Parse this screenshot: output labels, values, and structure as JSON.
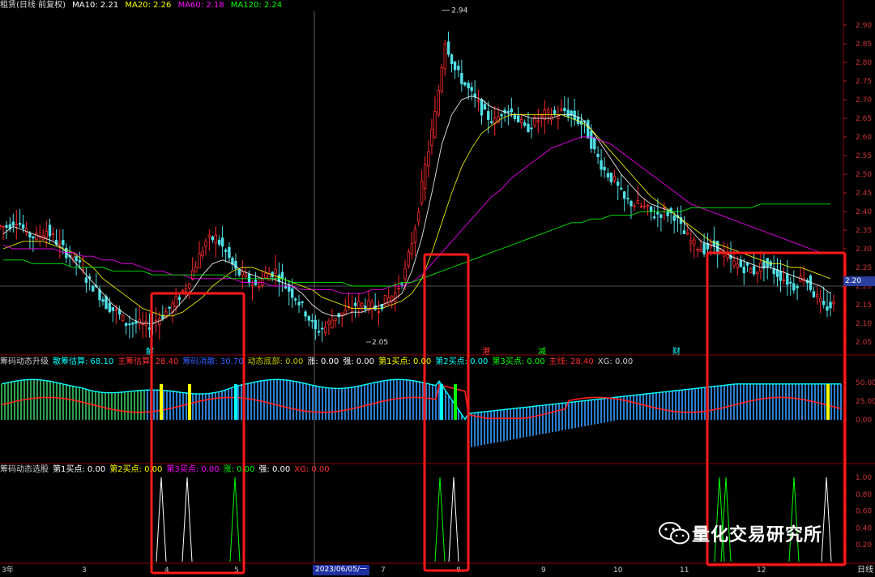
{
  "header": {
    "title": "租赁(日线 前复权)",
    "ma": [
      {
        "label": "MA10: 2.21",
        "color": "#ffffff"
      },
      {
        "label": "MA20: 2.26",
        "color": "#ffff00"
      },
      {
        "label": "MA60: 2.18",
        "color": "#ff00ff"
      },
      {
        "label": "MA120: 2.24",
        "color": "#00ff00"
      }
    ]
  },
  "sub1_header": [
    {
      "label": "筹码动态升级",
      "color": "#cfcfcf"
    },
    {
      "label": "散筹估算: 68.10",
      "color": "#00ffff"
    },
    {
      "label": "主筹估算: 28.40",
      "color": "#ff3030"
    },
    {
      "label": "筹码消散: 30.70",
      "color": "#3060ff"
    },
    {
      "label": "动态底部: 0.00",
      "color": "#c8c800"
    },
    {
      "label": "涨: 0.00",
      "color": "#ffffff"
    },
    {
      "label": "强: 0.00",
      "color": "#ffffff"
    },
    {
      "label": "第1买点: 0.00",
      "color": "#ffff00"
    },
    {
      "label": "第2买点: 0.00",
      "color": "#00ffff"
    },
    {
      "label": "第3买点: 0.00",
      "color": "#00ff00"
    },
    {
      "label": "主线: 28.40",
      "color": "#ff3030"
    },
    {
      "label": "XG: 0.00",
      "color": "#cfcfcf"
    }
  ],
  "sub2_header": [
    {
      "label": "筹码动态选股",
      "color": "#cfcfcf"
    },
    {
      "label": "第1买点: 0.00",
      "color": "#ffffff"
    },
    {
      "label": "第2买点: 0.00",
      "color": "#ffff00"
    },
    {
      "label": "第3买点: 0.00",
      "color": "#ff00ff"
    },
    {
      "label": "涨: 0.00",
      "color": "#00ff00"
    },
    {
      "label": "强: 0.00",
      "color": "#ffffff"
    },
    {
      "label": "XG: 0.00",
      "color": "#ff3030"
    }
  ],
  "annotations": {
    "high_label": "2.94",
    "low_label": "2.05",
    "current_price": "2.20",
    "markers": [
      {
        "text": "解",
        "color": "#00ffff",
        "x": 180
      },
      {
        "text": "港",
        "color": "#ff3030",
        "x": 595
      },
      {
        "text": "减",
        "color": "#00ff00",
        "x": 664
      },
      {
        "text": "财",
        "color": "#00ffff",
        "x": 830
      }
    ]
  },
  "x_axis": {
    "labels": [
      {
        "text": "3年",
        "x": 2
      },
      {
        "text": "3",
        "x": 101
      },
      {
        "text": "4",
        "x": 203
      },
      {
        "text": "5",
        "x": 289
      },
      {
        "text": "7",
        "x": 470
      },
      {
        "text": "8",
        "x": 563
      },
      {
        "text": "9",
        "x": 668
      },
      {
        "text": "10",
        "x": 757
      },
      {
        "text": "11",
        "x": 839
      },
      {
        "text": "12",
        "x": 934
      }
    ],
    "date_box": "2023/06/05/一",
    "timeframe": "日线"
  },
  "watermark": "量化交易研究所",
  "chart_data": [
    {
      "type": "candlestick",
      "title": "租赁(日线 前复权)",
      "y_ticks": [
        "2.90",
        "2.85",
        "2.80",
        "2.75",
        "2.70",
        "2.65",
        "2.60",
        "2.55",
        "2.50",
        "2.45",
        "2.40",
        "2.35",
        "2.30",
        "2.25",
        "2.20",
        "2.15",
        "2.10",
        "2.05"
      ],
      "ylim": [
        2.03,
        2.94
      ],
      "high": 2.94,
      "low": 2.05,
      "current": 2.2,
      "series": [
        {
          "name": "MA10",
          "value": 2.21,
          "color": "#ffffff"
        },
        {
          "name": "MA20",
          "value": 2.26,
          "color": "#ffff00"
        },
        {
          "name": "MA60",
          "value": 2.18,
          "color": "#ff00ff"
        },
        {
          "name": "MA120",
          "value": 2.24,
          "color": "#00ff00"
        }
      ],
      "close_path": [
        2.36,
        2.38,
        2.34,
        2.33,
        2.35,
        2.32,
        2.29,
        2.27,
        2.22,
        2.19,
        2.15,
        2.13,
        2.1,
        2.1,
        2.09,
        2.11,
        2.13,
        2.16,
        2.2,
        2.26,
        2.32,
        2.33,
        2.29,
        2.24,
        2.22,
        2.2,
        2.23,
        2.24,
        2.2,
        2.17,
        2.13,
        2.08,
        2.09,
        2.12,
        2.13,
        2.15,
        2.15,
        2.14,
        2.16,
        2.18,
        2.24,
        2.36,
        2.52,
        2.66,
        2.86,
        2.78,
        2.74,
        2.7,
        2.66,
        2.64,
        2.68,
        2.66,
        2.62,
        2.64,
        2.66,
        2.66,
        2.67,
        2.65,
        2.63,
        2.56,
        2.51,
        2.48,
        2.43,
        2.42,
        2.41,
        2.39,
        2.4,
        2.39,
        2.34,
        2.31,
        2.3,
        2.31,
        2.28,
        2.26,
        2.25,
        2.24,
        2.26,
        2.24,
        2.22,
        2.2,
        2.23,
        2.18,
        2.14,
        2.15
      ],
      "ma10_path": [
        2.34,
        2.36,
        2.35,
        2.34,
        2.33,
        2.32,
        2.3,
        2.27,
        2.24,
        2.21,
        2.18,
        2.15,
        2.13,
        2.11,
        2.1,
        2.1,
        2.11,
        2.13,
        2.16,
        2.19,
        2.23,
        2.26,
        2.27,
        2.26,
        2.24,
        2.23,
        2.22,
        2.22,
        2.21,
        2.2,
        2.18,
        2.15,
        2.13,
        2.12,
        2.12,
        2.13,
        2.13,
        2.14,
        2.15,
        2.16,
        2.18,
        2.24,
        2.33,
        2.45,
        2.58,
        2.66,
        2.7,
        2.71,
        2.7,
        2.68,
        2.67,
        2.66,
        2.66,
        2.65,
        2.65,
        2.65,
        2.66,
        2.66,
        2.65,
        2.62,
        2.58,
        2.54,
        2.5,
        2.47,
        2.44,
        2.42,
        2.41,
        2.4,
        2.38,
        2.35,
        2.32,
        2.31,
        2.3,
        2.28,
        2.27,
        2.26,
        2.25,
        2.25,
        2.24,
        2.23,
        2.22,
        2.21,
        2.2,
        2.18
      ],
      "ma20_path": [
        2.3,
        2.31,
        2.32,
        2.32,
        2.32,
        2.31,
        2.3,
        2.29,
        2.27,
        2.25,
        2.22,
        2.2,
        2.18,
        2.16,
        2.14,
        2.13,
        2.12,
        2.12,
        2.13,
        2.15,
        2.17,
        2.2,
        2.22,
        2.24,
        2.25,
        2.25,
        2.24,
        2.23,
        2.22,
        2.21,
        2.2,
        2.19,
        2.17,
        2.16,
        2.15,
        2.14,
        2.14,
        2.14,
        2.14,
        2.15,
        2.16,
        2.18,
        2.22,
        2.29,
        2.37,
        2.45,
        2.52,
        2.57,
        2.61,
        2.63,
        2.65,
        2.66,
        2.66,
        2.66,
        2.66,
        2.66,
        2.66,
        2.65,
        2.64,
        2.62,
        2.59,
        2.56,
        2.53,
        2.5,
        2.47,
        2.44,
        2.42,
        2.4,
        2.38,
        2.36,
        2.34,
        2.32,
        2.31,
        2.3,
        2.29,
        2.28,
        2.27,
        2.26,
        2.26,
        2.25,
        2.25,
        2.24,
        2.23,
        2.22
      ],
      "ma60_path": [
        2.31,
        2.3,
        2.3,
        2.3,
        2.3,
        2.3,
        2.29,
        2.29,
        2.28,
        2.28,
        2.27,
        2.27,
        2.26,
        2.26,
        2.25,
        2.24,
        2.24,
        2.23,
        2.23,
        2.22,
        2.22,
        2.22,
        2.22,
        2.22,
        2.21,
        2.21,
        2.21,
        2.2,
        2.2,
        2.2,
        2.19,
        2.19,
        2.19,
        2.19,
        2.18,
        2.18,
        2.18,
        2.19,
        2.19,
        2.2,
        2.2,
        2.21,
        2.23,
        2.26,
        2.29,
        2.32,
        2.35,
        2.38,
        2.41,
        2.44,
        2.46,
        2.49,
        2.51,
        2.53,
        2.55,
        2.57,
        2.58,
        2.59,
        2.6,
        2.6,
        2.59,
        2.58,
        2.56,
        2.54,
        2.52,
        2.5,
        2.48,
        2.46,
        2.44,
        2.42,
        2.41,
        2.4,
        2.39,
        2.38,
        2.37,
        2.36,
        2.35,
        2.34,
        2.33,
        2.32,
        2.31,
        2.3,
        2.29,
        2.29
      ],
      "ma120_path": [
        2.27,
        2.27,
        2.27,
        2.26,
        2.26,
        2.26,
        2.26,
        2.25,
        2.25,
        2.25,
        2.25,
        2.24,
        2.24,
        2.24,
        2.24,
        2.23,
        2.23,
        2.23,
        2.23,
        2.23,
        2.23,
        2.23,
        2.23,
        2.22,
        2.22,
        2.22,
        2.22,
        2.22,
        2.22,
        2.21,
        2.21,
        2.21,
        2.21,
        2.21,
        2.21,
        2.2,
        2.2,
        2.2,
        2.2,
        2.2,
        2.21,
        2.21,
        2.22,
        2.23,
        2.24,
        2.25,
        2.26,
        2.27,
        2.28,
        2.29,
        2.3,
        2.31,
        2.32,
        2.33,
        2.34,
        2.35,
        2.36,
        2.37,
        2.37,
        2.38,
        2.38,
        2.39,
        2.39,
        2.39,
        2.4,
        2.4,
        2.4,
        2.4,
        2.4,
        2.41,
        2.41,
        2.41,
        2.41,
        2.41,
        2.41,
        2.41,
        2.42,
        2.42,
        2.42,
        2.42,
        2.42,
        2.42,
        2.42,
        2.42
      ]
    },
    {
      "type": "bar",
      "title": "筹码动态升级",
      "y_ticks": [
        "50.00",
        "25.00",
        "0.00"
      ],
      "ylim": [
        -40,
        75
      ],
      "series": [
        {
          "name": "散筹估算",
          "value": 68.1,
          "color": "#00ffff"
        },
        {
          "name": "主筹估算",
          "value": 28.4,
          "color": "#ff3030"
        }
      ]
    },
    {
      "type": "bar",
      "title": "筹码动态选股",
      "y_ticks": [
        "1.00",
        "0.80",
        "0.60",
        "0.40",
        "0.20"
      ],
      "ylim": [
        0,
        1.05
      ]
    }
  ]
}
